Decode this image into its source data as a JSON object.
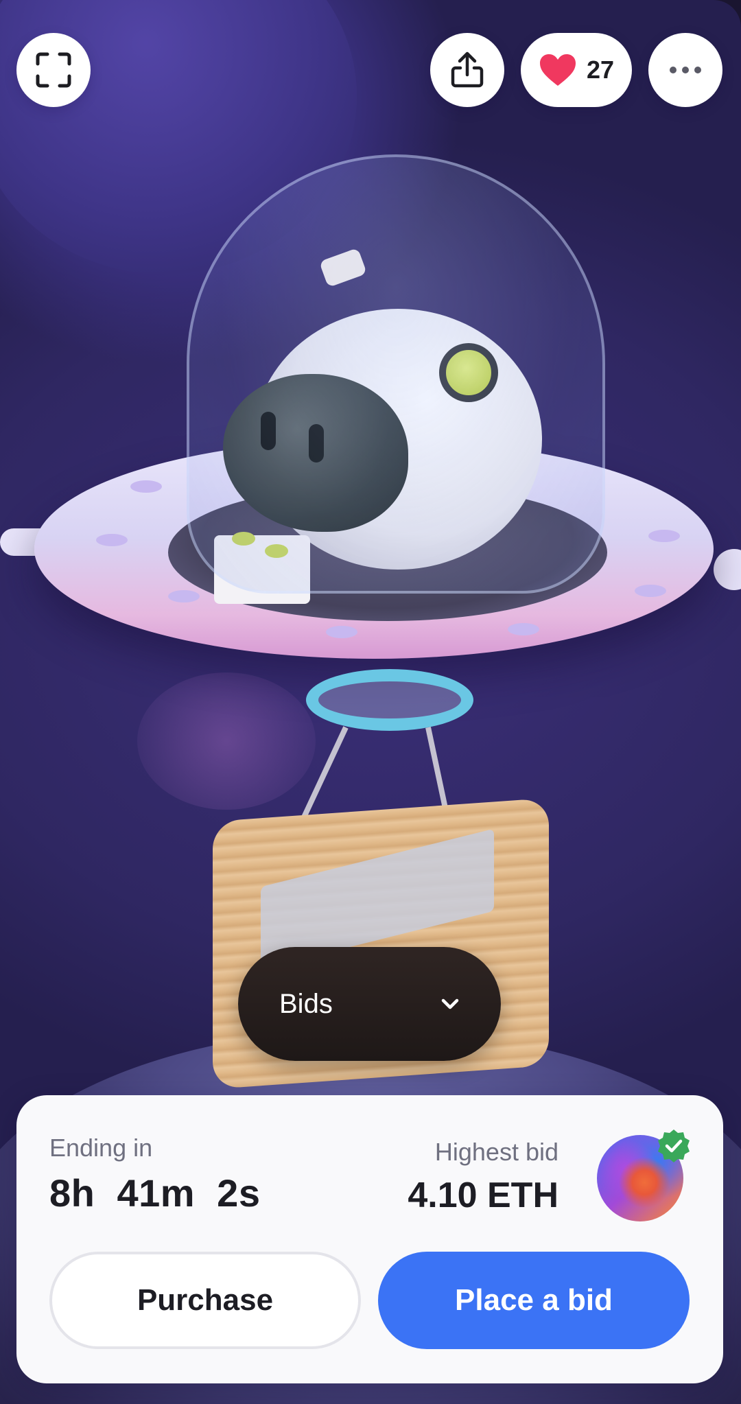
{
  "top_bar": {
    "likes_count": "27",
    "fullscreen_icon": "fullscreen-icon",
    "share_icon": "share-icon",
    "heart_icon": "heart-icon",
    "more_icon": "more-icon"
  },
  "bids_dropdown": {
    "label": "Bids",
    "icon": "chevron-down-icon"
  },
  "auction": {
    "ending_label": "Ending in",
    "ending_value": "8h  41m  2s",
    "highest_bid_label": "Highest bid",
    "highest_bid_value": "4.10 ETH",
    "verified_icon": "verified-check-icon"
  },
  "actions": {
    "purchase_label": "Purchase",
    "place_bid_label": "Place a bid"
  },
  "colors": {
    "accent": "#3b73f5",
    "heart": "#f0385f",
    "verified": "#3aa85a",
    "bids_pill": "#231b1a"
  }
}
